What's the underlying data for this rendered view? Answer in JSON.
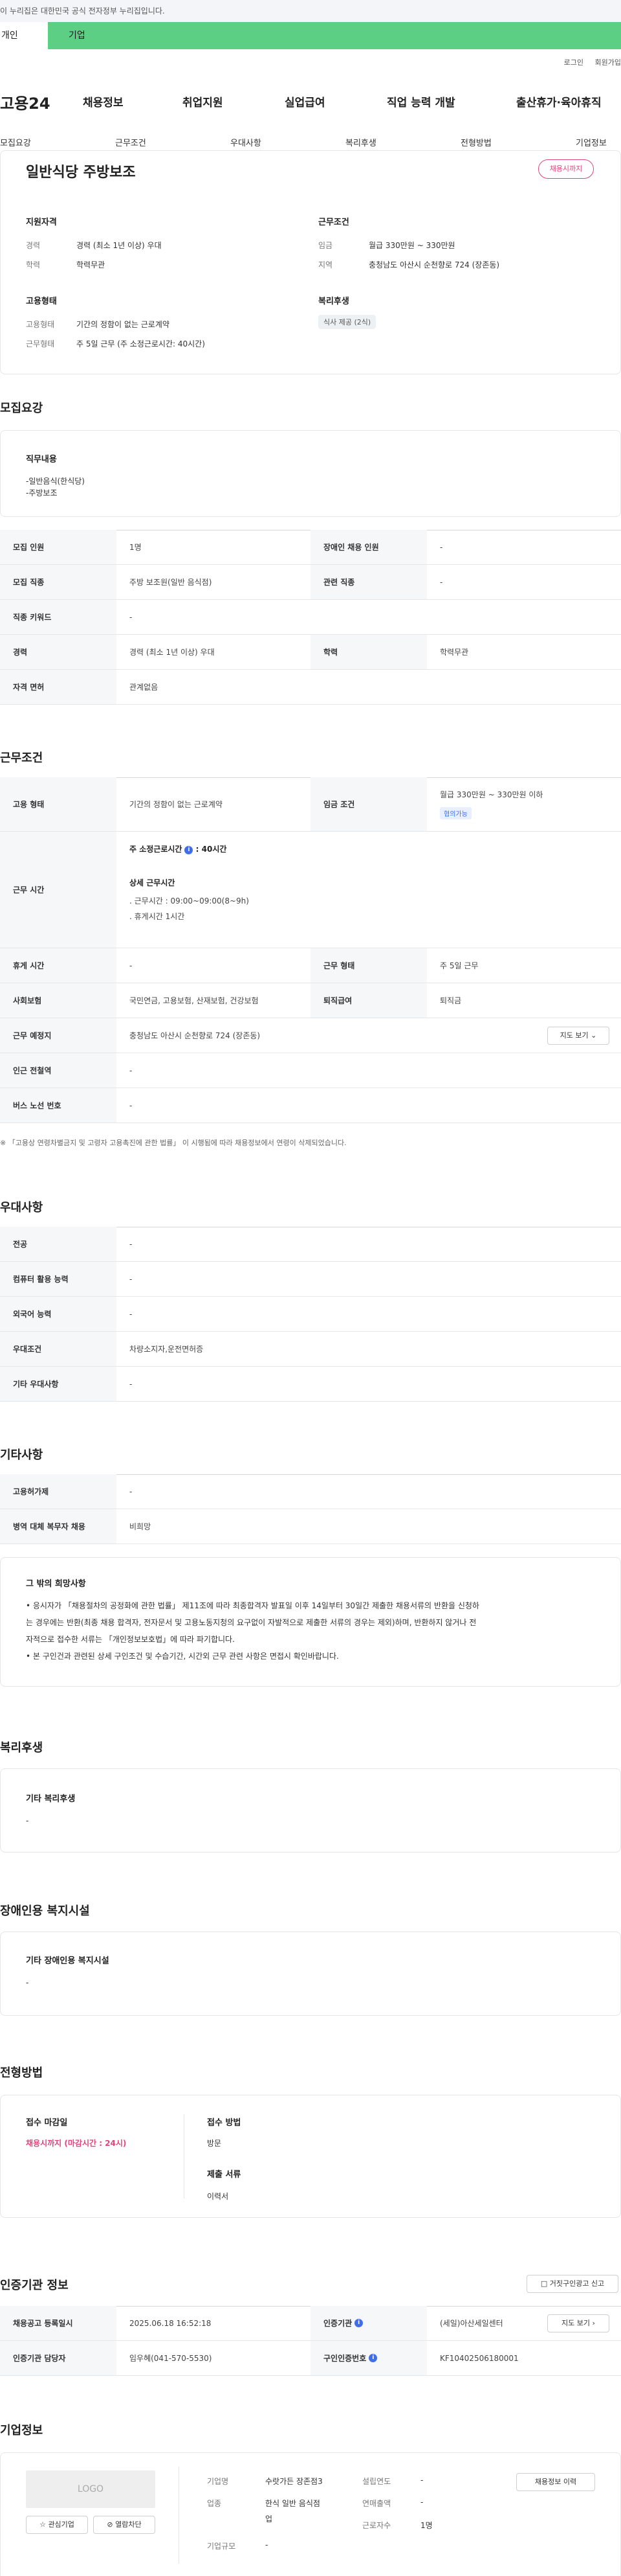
{
  "gov_banner": "이 누리집은 대한민국 공식 전자정부 누리집입니다.",
  "tabs": {
    "person": "개인",
    "company": "기업"
  },
  "util_links": {
    "login": "로그인",
    "join": "회원가입"
  },
  "logo": "고용24",
  "gnb": [
    "채용정보",
    "취업지원",
    "실업급여",
    "직업 능력 개발",
    "출산휴가·육아휴직"
  ],
  "subnav": [
    "모집요강",
    "근무조건",
    "우대사항",
    "복리후생",
    "전형방법",
    "기업정보"
  ],
  "summary": {
    "title": "일반식당 주방보조",
    "deadline_badge": "채용시까지",
    "qualification": {
      "heading": "지원자격",
      "items": [
        {
          "k": "경력",
          "v": "경력 (최소 1년 이상) 우대"
        },
        {
          "k": "학력",
          "v": "학력무관"
        }
      ]
    },
    "conditions": {
      "heading": "근무조건",
      "items": [
        {
          "k": "임금",
          "v": "월급 330만원 ~ 330만원"
        },
        {
          "k": "지역",
          "v": "충청남도 아산시 순천향로 724 (장존동)"
        }
      ]
    },
    "employment": {
      "heading": "고용형태",
      "items": [
        {
          "k": "고용형태",
          "v": "기간의 정함이 없는 근로계약"
        },
        {
          "k": "근무형태",
          "v": "주 5일 근무 (주 소정근로시간: 40시간)"
        }
      ]
    },
    "benefits": {
      "heading": "복리후생",
      "chip": "식사 제공 (2식)"
    }
  },
  "recruit": {
    "section_title": "모집요강",
    "duty_heading": "직무내용",
    "duty_lines": [
      "-일반음식(한식당)",
      "-주방보조"
    ],
    "rows": [
      {
        "k1": "모집 인원",
        "v1": "1명",
        "k2": "장애인 채용 인원",
        "v2": "-"
      },
      {
        "k1": "모집 직종",
        "v1": "주방 보조원(일반 음식점)",
        "k2": "관련 직종",
        "v2": "-"
      },
      {
        "k1": "직종 키워드",
        "v1": "-"
      },
      {
        "k1": "경력",
        "v1": "경력 (최소 1년 이상) 우대",
        "k2": "학력",
        "v2": "학력무관"
      },
      {
        "k1": "자격 면허",
        "v1": "관계없음"
      }
    ]
  },
  "work": {
    "section_title": "근무조건",
    "employ_k": "고용 형태",
    "employ_v": "기간의 정함이 없는 근로계약",
    "wage_k": "임금 조건",
    "wage_v": "월급 330만원 ~ 330만원 이하",
    "wage_chip": "협의가능",
    "time_k": "근무 시간",
    "hours_label": "주 소정근로시간",
    "hours_value": ": 40시간",
    "detail_heading": "상세 근무시간",
    "detail_lines": [
      ". 근무시간 : 09:00~09:00(8~9h)",
      ". 휴게시간 1시간"
    ],
    "rows": [
      {
        "k1": "휴게 시간",
        "v1": "-",
        "k2": "근무 형태",
        "v2": "주 5일 근무"
      },
      {
        "k1": "사회보험",
        "v1": "국민연금, 고용보험, 산재보험, 건강보험",
        "k2": "퇴직급여",
        "v2": "퇴직금"
      }
    ],
    "place_k": "근무 예정지",
    "place_v": "충청남도 아산시 순천향로 724 (장존동)",
    "map_button": "지도 보기",
    "industrial_k": "인근 전철역",
    "industrial_v": "-",
    "bus_k": "버스 노선 번호",
    "bus_v": "-",
    "notice": "※ 「고용상 연령차별금지 및 고령자 고용촉진에 관한 법률」 이 시행됨에 따라 채용정보에서 연령이 삭제되었습니다."
  },
  "preference": {
    "section_title": "우대사항",
    "rows": [
      {
        "k": "전공",
        "v": "-"
      },
      {
        "k": "컴퓨터 활용 능력",
        "v": "-"
      },
      {
        "k": "외국어 능력",
        "v": "-"
      },
      {
        "k": "우대조건",
        "v": "차량소지자,운전면허증"
      },
      {
        "k": "기타 우대사항",
        "v": "-"
      }
    ]
  },
  "etc": {
    "section_title": "기타사항",
    "rows": [
      {
        "k": "고용허가제",
        "v": "-"
      },
      {
        "k": "병역 대체 복무자 채용",
        "v": "비희망"
      }
    ],
    "box_heading": "그 밖의 희망사항",
    "box_lines": [
      "• 응시자가 「채용절차의 공정화에 관한 법률」 제11조에 따라 최종합격자 발표일 이후 14일부터 30일간 제출한 채용서류의 반환을 신청하",
      "는 경우에는 반환(최종 채용 합격자, 전자문서 및 고용노동지청의 요구없이 자발적으로 제출한 서류의 경우는 제외)하며, 반환하지 않거나 전",
      "자적으로 접수한 서류는 「개인정보보호법」에 따라 파기합니다.",
      "• 본 구인건과 관련된 상세 구인조건 및 수습기간, 시간외 근무 관련 사항은 면접시 확인바랍니다."
    ]
  },
  "welfare": {
    "section_title": "복리후생",
    "heading": "기타 복리후생",
    "value": "-"
  },
  "disabled": {
    "section_title": "장애인용 복지시설",
    "heading": "기타 장애인용 복지시설",
    "value": "-"
  },
  "selection": {
    "section_title": "전형방법",
    "deadline_heading": "접수 마감일",
    "deadline_value": "채용시까지 (마감시간 : 24시)",
    "method_heading": "접수 방법",
    "method_value": "방문",
    "docs_heading": "제출 서류",
    "docs_value": "이력서"
  },
  "agency": {
    "section_title": "인증기관 정보",
    "report_button": "거짓구인광고 신고",
    "reg_k": "채용공고 등록일시",
    "reg_v": "2025.06.18 16:52:18",
    "org_k": "인증기관",
    "org_v": "(세일)아산세일센터",
    "map_button": "지도 보기",
    "mgr_k": "인증기관 담당자",
    "mgr_v": "임우혜(041-570-5530)",
    "num_k": "구인인증번호",
    "num_v": "KF10402506180001"
  },
  "company": {
    "section_title": "기업정보",
    "logo_placeholder": "LOGO",
    "interest_button": "관심기업",
    "block_button": "열람차단",
    "biz_k": "기업명",
    "biz_v": "수랏가든 장존점3",
    "industry_k": "업종",
    "industry_v1": "한식 일반 음식점",
    "industry_v2": "업",
    "size_k": "기업규모",
    "size_v": "-",
    "est_k": "설립연도",
    "est_v": "-",
    "sales_k": "연매출액",
    "sales_v": "-",
    "staff_k": "근로자수",
    "staff_v": "1명",
    "history_button": "채용정보 이력"
  }
}
